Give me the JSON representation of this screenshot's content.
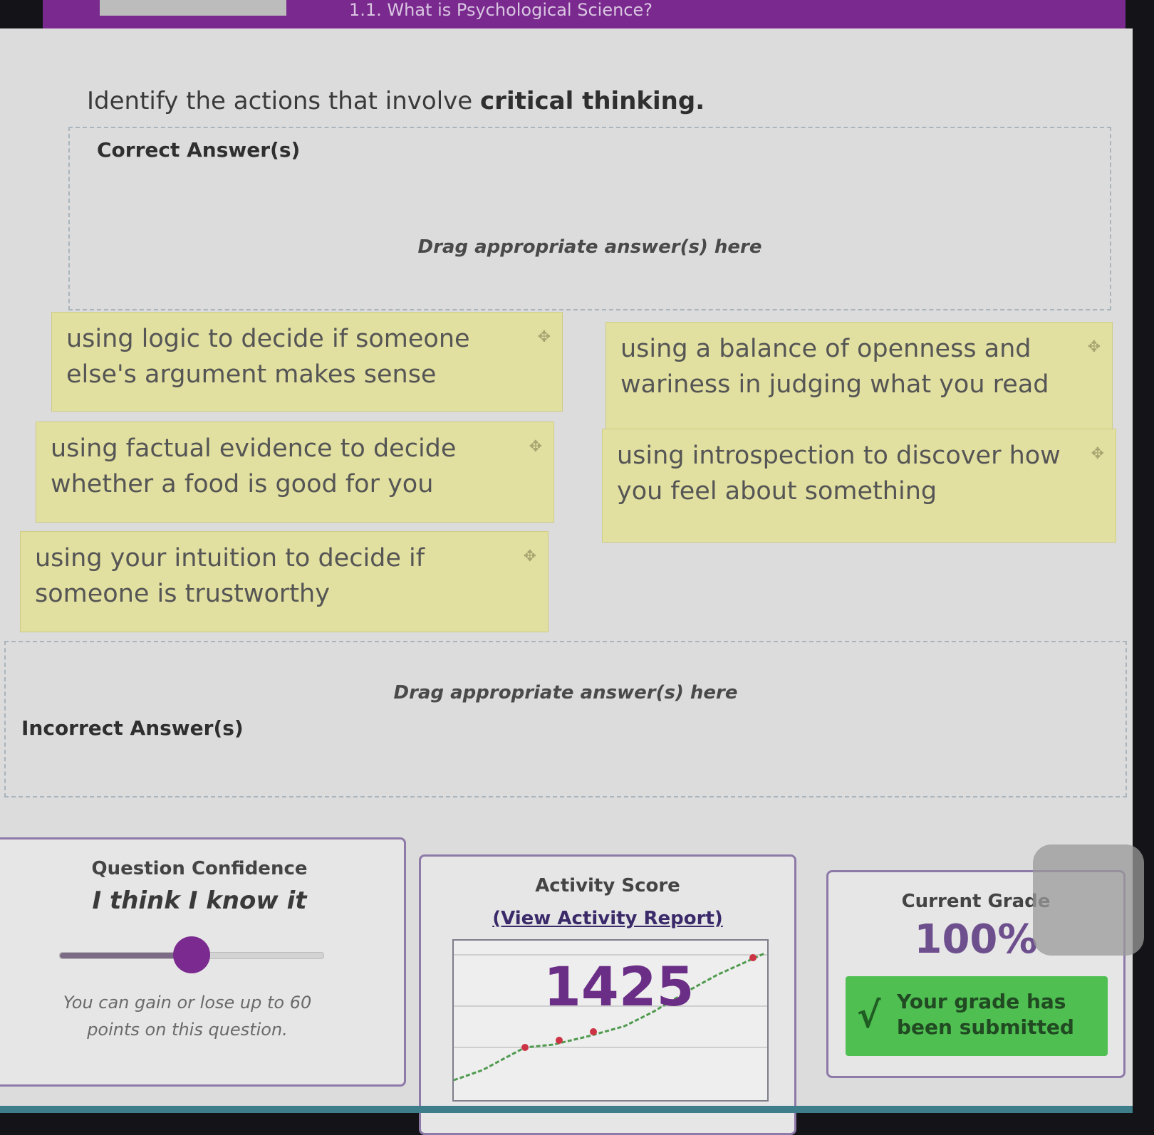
{
  "header": {
    "breadcrumb": "1.1. What is Psychological Science?"
  },
  "question": {
    "prompt_prefix": "Identify the actions that involve ",
    "prompt_emphasis": "critical thinking."
  },
  "correct_zone": {
    "title": "Correct Answer(s)",
    "hint": "Drag appropriate answer(s) here"
  },
  "incorrect_zone": {
    "title": "Incorrect Answer(s)",
    "hint": "Drag appropriate answer(s) here"
  },
  "answers": [
    {
      "text": "using logic to decide if someone else's argument makes sense",
      "icon": "drag-handle-icon"
    },
    {
      "text": "using a balance of openness and wariness in judging what you read",
      "icon": "drag-handle-icon"
    },
    {
      "text": "using factual evidence to decide whether a food is good for you",
      "icon": "drag-handle-icon"
    },
    {
      "text": "using introspection to discover how you feel about something",
      "icon": "drag-handle-icon"
    },
    {
      "text": "using your intuition to decide if someone is trustworthy",
      "icon": "drag-handle-icon"
    }
  ],
  "confidence": {
    "title": "Question Confidence",
    "value": "I think I know it",
    "slider_level": 0.5,
    "note": "You can gain or lose up to 60 points on this question."
  },
  "activity": {
    "title": "Activity Score",
    "report_link": "(View Activity Report)",
    "score": "1425"
  },
  "grade": {
    "title": "Current Grade",
    "value": "100%",
    "status": "Your grade has been submitted"
  },
  "colors": {
    "header": "#7a2a8f",
    "card": "#e2e0a0",
    "accent": "#7b2a8f",
    "success": "#4fbf52"
  }
}
